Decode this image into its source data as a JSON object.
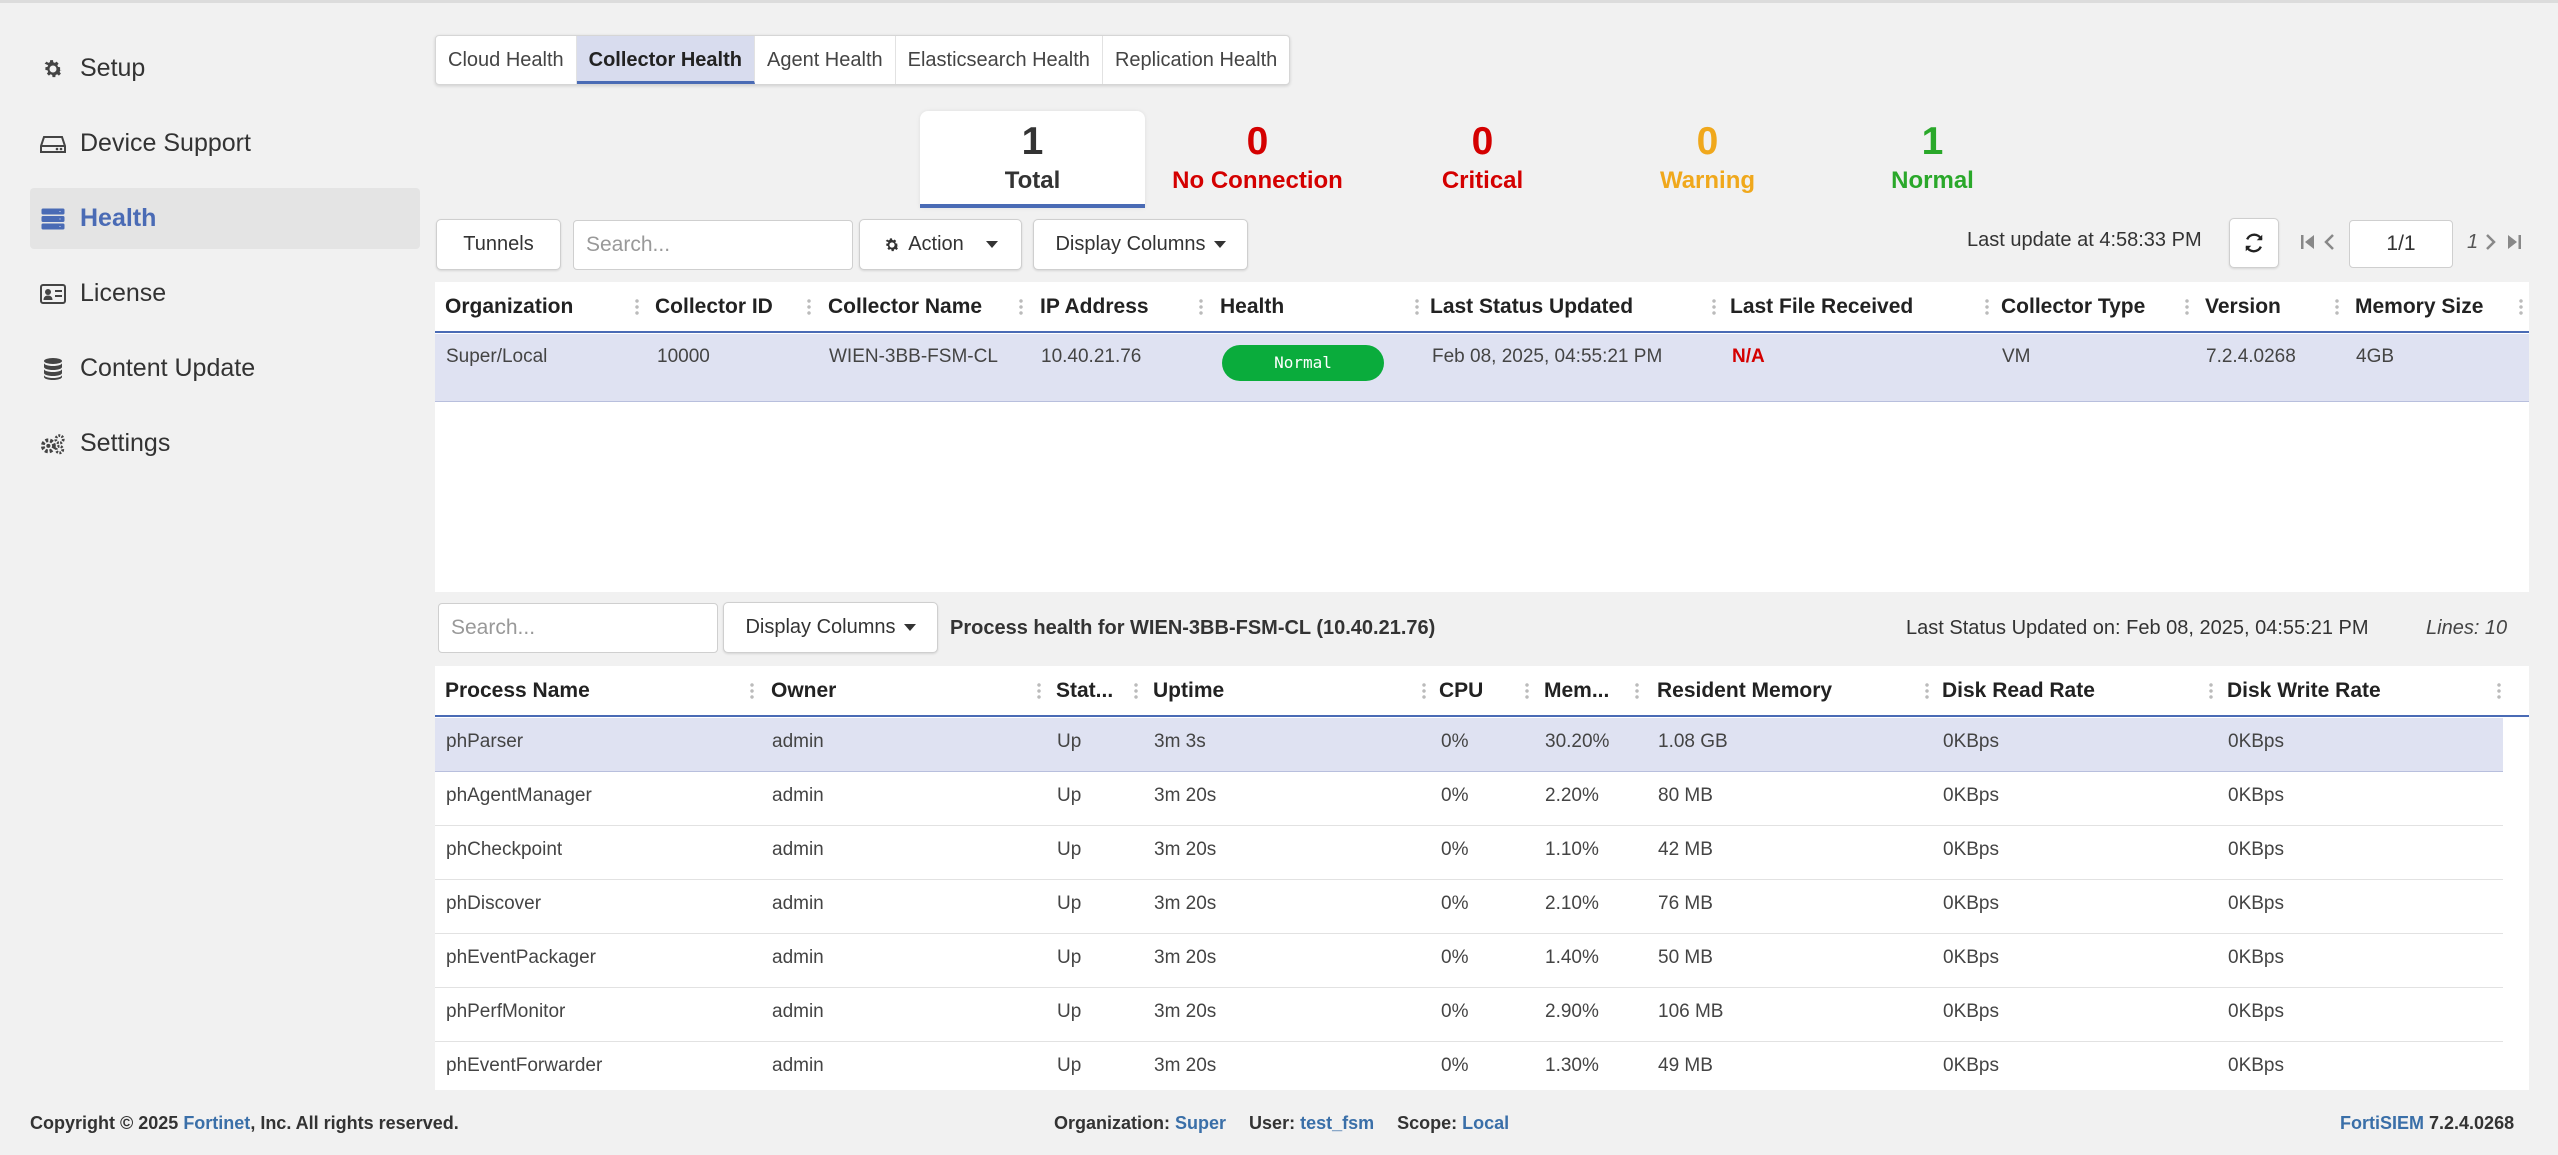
{
  "sidebar": {
    "items": [
      {
        "label": "Setup",
        "icon": "gear-icon"
      },
      {
        "label": "Device Support",
        "icon": "hard-drive-icon"
      },
      {
        "label": "Health",
        "icon": "server-icon"
      },
      {
        "label": "License",
        "icon": "id-card-icon"
      },
      {
        "label": "Content Update",
        "icon": "database-icon"
      },
      {
        "label": "Settings",
        "icon": "gears-icon"
      }
    ],
    "active": "Health"
  },
  "tabs": [
    "Cloud Health",
    "Collector Health",
    "Agent Health",
    "Elasticsearch Health",
    "Replication Health"
  ],
  "active_tab": "Collector Health",
  "summary": [
    {
      "value": "1",
      "label": "Total",
      "color": "#333333"
    },
    {
      "value": "0",
      "label": "No Connection",
      "color": "#d40000"
    },
    {
      "value": "0",
      "label": "Critical",
      "color": "#d40000"
    },
    {
      "value": "0",
      "label": "Warning",
      "color": "#f0a81c"
    },
    {
      "value": "1",
      "label": "Normal",
      "color": "#2aa82a"
    }
  ],
  "toolbar": {
    "tunnels_label": "Tunnels",
    "search_placeholder": "Search...",
    "action_label": "Action",
    "display_columns_label": "Display Columns",
    "last_update": "Last update at 4:58:33 PM",
    "page_value": "1/1",
    "page_total": "1"
  },
  "collectors": {
    "columns": [
      "Organization",
      "Collector ID",
      "Collector Name",
      "IP Address",
      "Health",
      "Last Status Updated",
      "Last File Received",
      "Collector Type",
      "Version",
      "Memory Size"
    ],
    "rows": [
      {
        "organization": "Super/Local",
        "collector_id": "10000",
        "collector_name": "WIEN-3BB-FSM-CL",
        "ip": "10.40.21.76",
        "health": "Normal",
        "last_status": "Feb 08, 2025, 04:55:21 PM",
        "last_file": "N/A",
        "type": "VM",
        "version": "7.2.4.0268",
        "memory": "4GB"
      }
    ]
  },
  "process": {
    "search_placeholder": "Search...",
    "display_columns_label": "Display Columns",
    "title": "Process health for WIEN-3BB-FSM-CL (10.40.21.76)",
    "last_status": "Last Status Updated on: Feb 08, 2025, 04:55:21 PM",
    "lines": "Lines: 10",
    "columns": [
      "Process Name",
      "Owner",
      "Stat...",
      "Uptime",
      "CPU",
      "Mem...",
      "Resident Memory",
      "Disk Read Rate",
      "Disk Write Rate"
    ],
    "rows": [
      {
        "name": "phParser",
        "owner": "admin",
        "status": "Up",
        "uptime": "3m 3s",
        "cpu": "0%",
        "mem": "30.20%",
        "res": "1.08 GB",
        "read": "0KBps",
        "write": "0KBps"
      },
      {
        "name": "phAgentManager",
        "owner": "admin",
        "status": "Up",
        "uptime": "3m 20s",
        "cpu": "0%",
        "mem": "2.20%",
        "res": "80 MB",
        "read": "0KBps",
        "write": "0KBps"
      },
      {
        "name": "phCheckpoint",
        "owner": "admin",
        "status": "Up",
        "uptime": "3m 20s",
        "cpu": "0%",
        "mem": "1.10%",
        "res": "42 MB",
        "read": "0KBps",
        "write": "0KBps"
      },
      {
        "name": "phDiscover",
        "owner": "admin",
        "status": "Up",
        "uptime": "3m 20s",
        "cpu": "0%",
        "mem": "2.10%",
        "res": "76 MB",
        "read": "0KBps",
        "write": "0KBps"
      },
      {
        "name": "phEventPackager",
        "owner": "admin",
        "status": "Up",
        "uptime": "3m 20s",
        "cpu": "0%",
        "mem": "1.40%",
        "res": "50 MB",
        "read": "0KBps",
        "write": "0KBps"
      },
      {
        "name": "phPerfMonitor",
        "owner": "admin",
        "status": "Up",
        "uptime": "3m 20s",
        "cpu": "0%",
        "mem": "2.90%",
        "res": "106 MB",
        "read": "0KBps",
        "write": "0KBps"
      },
      {
        "name": "phEventForwarder",
        "owner": "admin",
        "status": "Up",
        "uptime": "3m 20s",
        "cpu": "0%",
        "mem": "1.30%",
        "res": "49 MB",
        "read": "0KBps",
        "write": "0KBps"
      }
    ]
  },
  "footer": {
    "copyright_pre": "Copyright © 2025 ",
    "company": "Fortinet",
    "copyright_post": ", Inc. All rights reserved.",
    "org_label": "Organization:",
    "org_value": "Super",
    "user_label": "User:",
    "user_value": "test_fsm",
    "scope_label": "Scope:",
    "scope_value": "Local",
    "product": "FortiSIEM",
    "version": "7.2.4.0268"
  },
  "colors": {
    "accent": "#4a6bb5",
    "normal_pill": "#0aac3c",
    "na_red": "#d40000"
  }
}
